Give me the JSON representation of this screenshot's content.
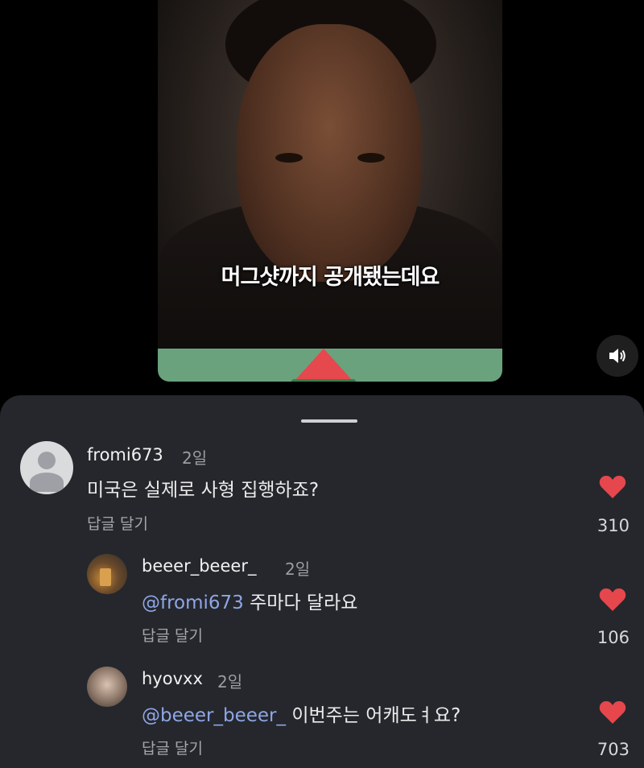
{
  "video": {
    "subtitle": "머그샷까지 공개됐는데요",
    "volume_icon": "speaker-icon"
  },
  "comments": [
    {
      "username": "fromi673",
      "time": "2일",
      "mention": "",
      "text": "미국은 실제로 사형 집행하죠?",
      "reply_label": "답글 달기",
      "likes": "310"
    },
    {
      "username": "beeer_beeer_",
      "time": "2일",
      "mention": "@fromi673",
      "text": " 주마다 달라요",
      "reply_label": "답글 달기",
      "likes": "106"
    },
    {
      "username": "hyovxx",
      "time": "2일",
      "mention": "@beeer_beeer_",
      "text": " 이번주는 어캐도ㅕ요?",
      "reply_label": "답글 달기",
      "likes": "703"
    }
  ],
  "colors": {
    "sheet_bg": "#25272c",
    "mention": "#8fa6e6",
    "heart": "#e5474d",
    "video_bar": "#6aa27d"
  }
}
